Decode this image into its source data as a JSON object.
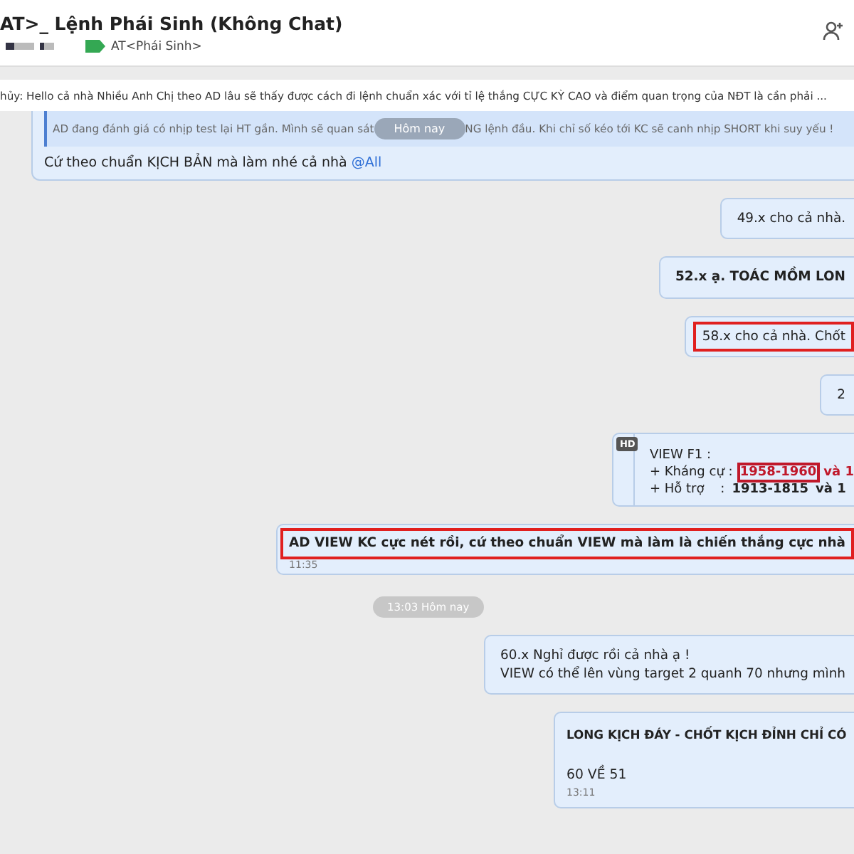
{
  "header": {
    "title": "AT>_ Lệnh Phái Sinh (Không Chat)",
    "tag": "AT<Phái Sinh>"
  },
  "pinned": {
    "text": "hủy: Hello cả nhà Nhiều Anh Chị theo AD lâu sẽ thấy được cách đi lệnh chuẩn xác với tỉ lệ thắng CỰC KỲ CAO và điểm quan trọng của NĐT là cần phải ..."
  },
  "top_message": {
    "quote_before": "AD đang đánh giá có nhịp test lại HT gần. Mình sẽ quan sát",
    "date_pill": "Hôm nay",
    "quote_after": "NG lệnh đầu. Khi chỉ số kéo tới KC sẽ canh nhịp SHORT khi suy yếu !",
    "text": "Cứ theo chuẩn KỊCH BẢN mà làm nhé cả nhà",
    "mention": "@All"
  },
  "messages": [
    {
      "kind": "text",
      "lines": [
        "49.x cho cả nhà."
      ],
      "bold": false,
      "highlighted": false
    },
    {
      "kind": "text",
      "lines": [
        "52.x ạ. TOÁC MỒM LON"
      ],
      "bold": true,
      "highlighted": false
    },
    {
      "kind": "text",
      "lines": [
        "58.x cho cả nhà. Chốt"
      ],
      "bold": false,
      "highlighted": true
    },
    {
      "kind": "text",
      "lines": [
        "2"
      ],
      "bold": false,
      "highlighted": false
    },
    {
      "kind": "levels",
      "badge": "HD",
      "title": "VIEW F1 :",
      "rows": [
        {
          "label": "+ Kháng cự :",
          "value": "1958-1960",
          "highlighted": true,
          "rest": "và 1"
        },
        {
          "label": "+ Hỗ trợ    :",
          "value": "1913-1815",
          "highlighted": false,
          "rest": "và 1"
        }
      ]
    },
    {
      "kind": "banner",
      "lines": [
        "AD VIEW KC cực nét rồi, cứ theo chuẩn VIEW mà làm là chiến thắng cực nhà"
      ],
      "bold": true,
      "highlighted": true,
      "time": "11:35"
    },
    {
      "kind": "pill",
      "text": "13:03 Hôm nay"
    },
    {
      "kind": "text",
      "lines": [
        "60.x Nghỉ được rồi cả nhà ạ !",
        "VIEW có thể lên vùng target 2 quanh 70 nhưng mình"
      ],
      "bold": false,
      "highlighted": false
    },
    {
      "kind": "card",
      "title": "LONG KỊCH ĐÁY - CHỐT KỊCH ĐỈNH CHỈ CÓ",
      "body": "60 VỀ 51",
      "time": "13:11"
    }
  ]
}
